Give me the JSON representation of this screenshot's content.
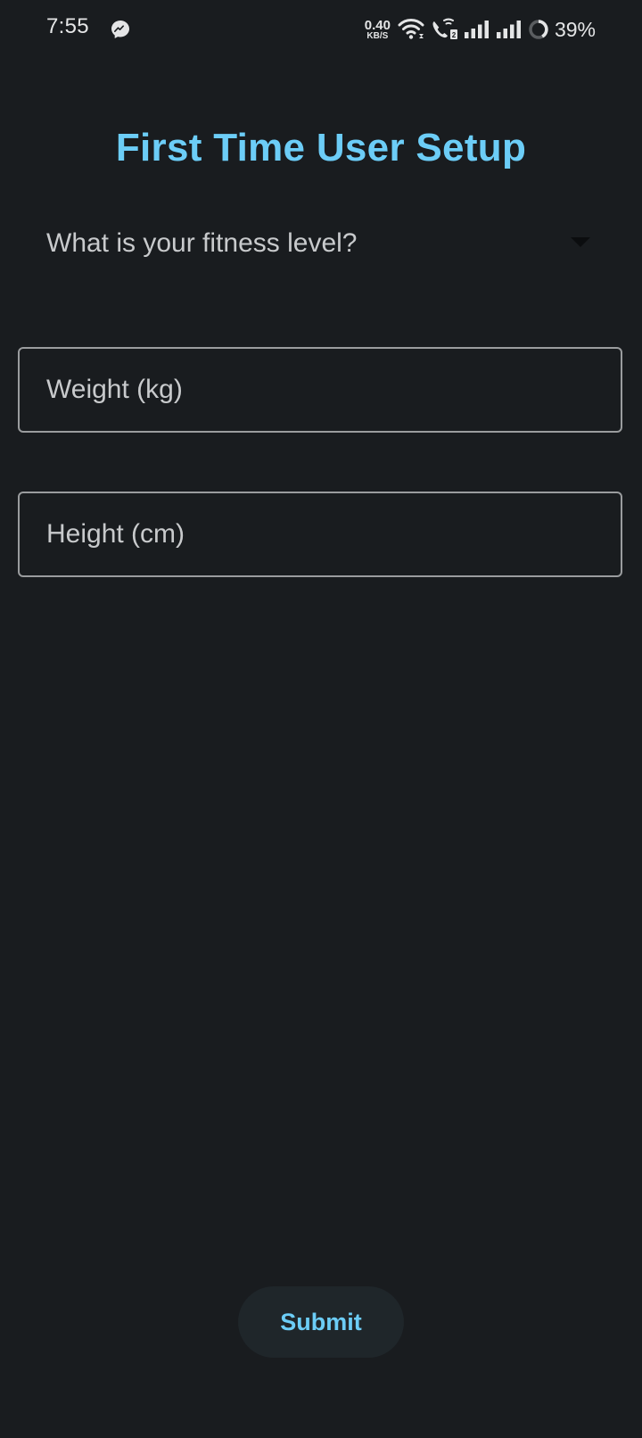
{
  "status_bar": {
    "time": "7:55",
    "notification_icon": "messenger-icon",
    "network_speed_value": "0.40",
    "network_speed_unit": "KB/S",
    "icons": [
      "wifi-icon",
      "wifi-calling-icon",
      "signal-icon",
      "signal-icon",
      "battery-icon"
    ],
    "battery": "39%"
  },
  "page": {
    "title": "First Time User Setup"
  },
  "form": {
    "fitness_level": {
      "placeholder": "What is your fitness level?",
      "icon": "dropdown-arrow-icon"
    },
    "weight": {
      "value": "",
      "placeholder": "Weight (kg)"
    },
    "height": {
      "value": "",
      "placeholder": "Height (cm)"
    },
    "submit_label": "Submit"
  },
  "colors": {
    "background": "#191c1f",
    "accent": "#6ccdf7",
    "field_border": "#9a9c9e",
    "button_bg": "#1f262a"
  }
}
